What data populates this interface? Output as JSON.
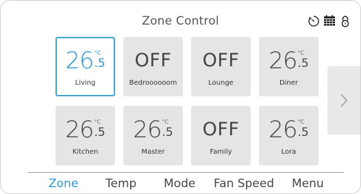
{
  "header": {
    "title": "Zone Control"
  },
  "status_icons": [
    "timer-icon",
    "calendar-icon",
    "lock-icon"
  ],
  "zones": [
    {
      "name": "Living",
      "state": "temp",
      "int": "26",
      "dec": ".5",
      "unit": "°C",
      "selected": true
    },
    {
      "name": "Bedroooooom",
      "state": "off",
      "text": "OFF"
    },
    {
      "name": "Lounge",
      "state": "off",
      "text": "OFF"
    },
    {
      "name": "Diner",
      "state": "temp",
      "int": "26",
      "dec": ".5",
      "unit": "°C"
    },
    {
      "name": "Kitchen",
      "state": "temp",
      "int": "26",
      "dec": ".5",
      "unit": "°C"
    },
    {
      "name": "Master",
      "state": "temp",
      "int": "26",
      "dec": ".5",
      "unit": "°C"
    },
    {
      "name": "Family",
      "state": "off",
      "text": "OFF"
    },
    {
      "name": "Lora",
      "state": "temp",
      "int": "26",
      "dec": ".5",
      "unit": "°C"
    }
  ],
  "nav": {
    "items": [
      "Zone",
      "Temp",
      "Mode",
      "Fan Speed",
      "Menu"
    ],
    "active": "Zone"
  },
  "colors": {
    "accent": "#2a97cc",
    "tile_bg": "#e5e5e5"
  }
}
